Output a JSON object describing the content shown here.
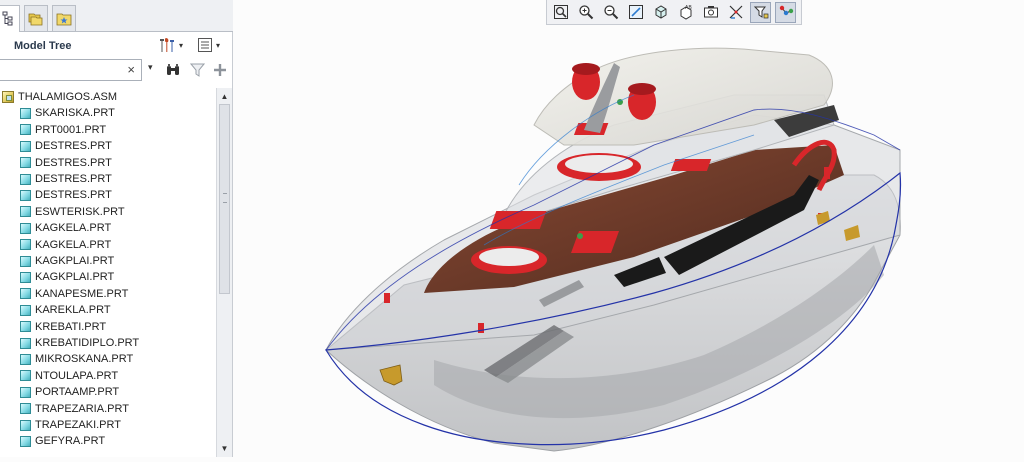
{
  "model_tree": {
    "title": "Model Tree",
    "search": {
      "value": "",
      "placeholder": ""
    },
    "clear_glyph": "×",
    "caret_glyph": "▾",
    "root": {
      "label": "THALAMIGOS.ASM",
      "icon": "assembly-icon"
    },
    "items": [
      {
        "label": "SKARISKA.PRT"
      },
      {
        "label": "PRT0001.PRT"
      },
      {
        "label": "DESTRES.PRT"
      },
      {
        "label": "DESTRES.PRT"
      },
      {
        "label": "DESTRES.PRT"
      },
      {
        "label": "DESTRES.PRT"
      },
      {
        "label": "ESWTERISK.PRT"
      },
      {
        "label": "KAGKELA.PRT"
      },
      {
        "label": "KAGKELA.PRT"
      },
      {
        "label": "KAGKPLAI.PRT"
      },
      {
        "label": "KAGKPLAI.PRT"
      },
      {
        "label": "KANAPESME.PRT"
      },
      {
        "label": "KAREKLA.PRT"
      },
      {
        "label": "KREBATI.PRT"
      },
      {
        "label": "KREBATIDIPLO.PRT"
      },
      {
        "label": "MIKROSKANA.PRT"
      },
      {
        "label": "NTOULAPA.PRT"
      },
      {
        "label": "PORTAAMP.PRT"
      },
      {
        "label": "TRAPEZARIA.PRT"
      },
      {
        "label": "TRAPEZAKI.PRT"
      },
      {
        "label": "GEFYRA.PRT"
      }
    ]
  },
  "colors": {
    "accent_red": "#d8262a",
    "deck_wood": "#6b3b2a",
    "hull_gray": "#c9cbce",
    "outline_blue": "#2433a8"
  }
}
